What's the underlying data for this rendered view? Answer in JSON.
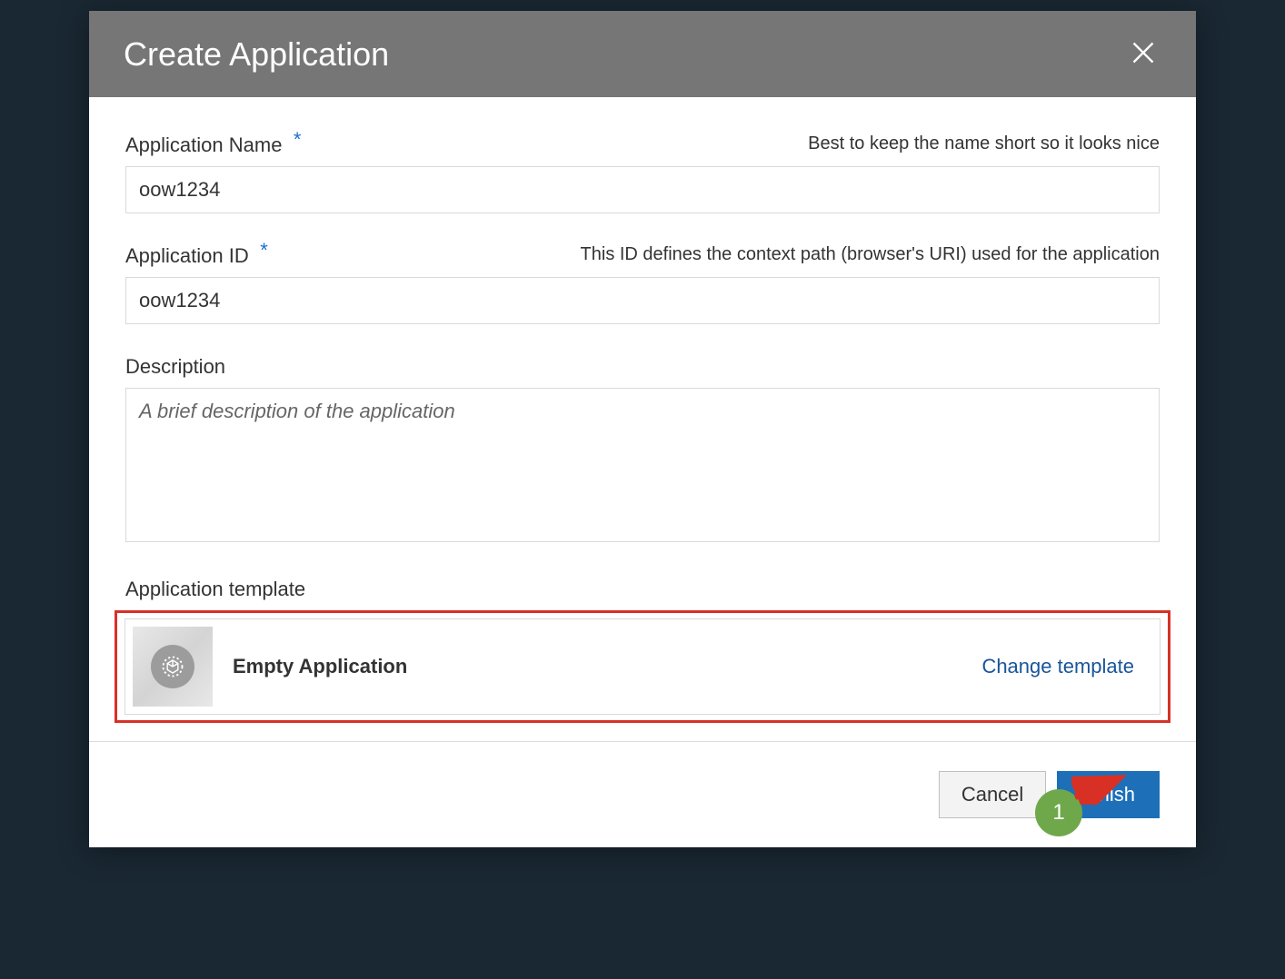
{
  "dialog": {
    "title": "Create Application",
    "close_label": "Close"
  },
  "fields": {
    "appName": {
      "label": "Application Name",
      "required": "*",
      "hint": "Best to keep the name short so it looks nice",
      "value": "oow1234"
    },
    "appId": {
      "label": "Application ID",
      "required": "*",
      "hint": "This ID defines the context path (browser's URI) used for the application",
      "value": "oow1234"
    },
    "description": {
      "label": "Description",
      "placeholder": "A brief description of the application",
      "value": ""
    },
    "template": {
      "label": "Application template",
      "selected_name": "Empty Application",
      "change_link": "Change template"
    }
  },
  "footer": {
    "cancel_label": "Cancel",
    "finish_label": "Finish"
  },
  "annotation": {
    "step": "1"
  }
}
